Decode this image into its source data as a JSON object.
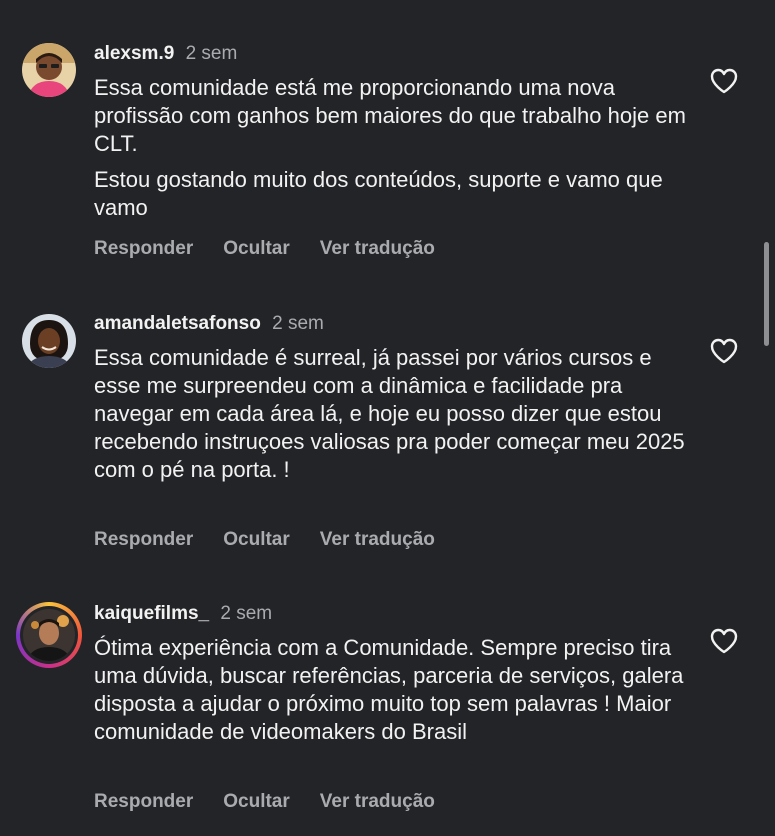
{
  "icons": {
    "like": "heart-outline-icon"
  },
  "colors": {
    "background": "#232427",
    "text_primary": "#f2f2f2",
    "text_secondary": "#a9abaf",
    "story_ring": [
      "#f9c33c",
      "#f0563a",
      "#c92f8a",
      "#7a36c6"
    ]
  },
  "comments": [
    {
      "username": "alexsm.9",
      "time": "2 sem",
      "paragraphs": [
        "Essa comunidade está me proporcionando uma nova profissão com ganhos bem maiores do que trabalho hoje em CLT.",
        "Estou gostando muito dos conteúdos, suporte e vamo que vamo"
      ],
      "actions": [
        "Responder",
        "Ocultar",
        "Ver tradução"
      ]
    },
    {
      "username": "amandaletsafonso",
      "time": "2 sem",
      "paragraphs": [
        "Essa comunidade é surreal, já passei por vários cursos e esse me surpreendeu com a dinâmica e facilidade pra navegar em cada área lá, e hoje eu posso dizer que estou recebendo instruçoes valiosas pra poder começar meu 2025 com o pé na porta. !"
      ],
      "actions": [
        "Responder",
        "Ocultar",
        "Ver tradução"
      ]
    },
    {
      "username": "kaiquefilms_",
      "time": "2 sem",
      "paragraphs": [
        "Ótima experiência com a Comunidade. Sempre preciso tira uma dúvida, buscar referências, parceria de serviços, galera disposta a ajudar o próximo muito top sem palavras ! Maior comunidade de videomakers do  Brasil"
      ],
      "actions": [
        "Responder",
        "Ocultar",
        "Ver tradução"
      ]
    }
  ]
}
